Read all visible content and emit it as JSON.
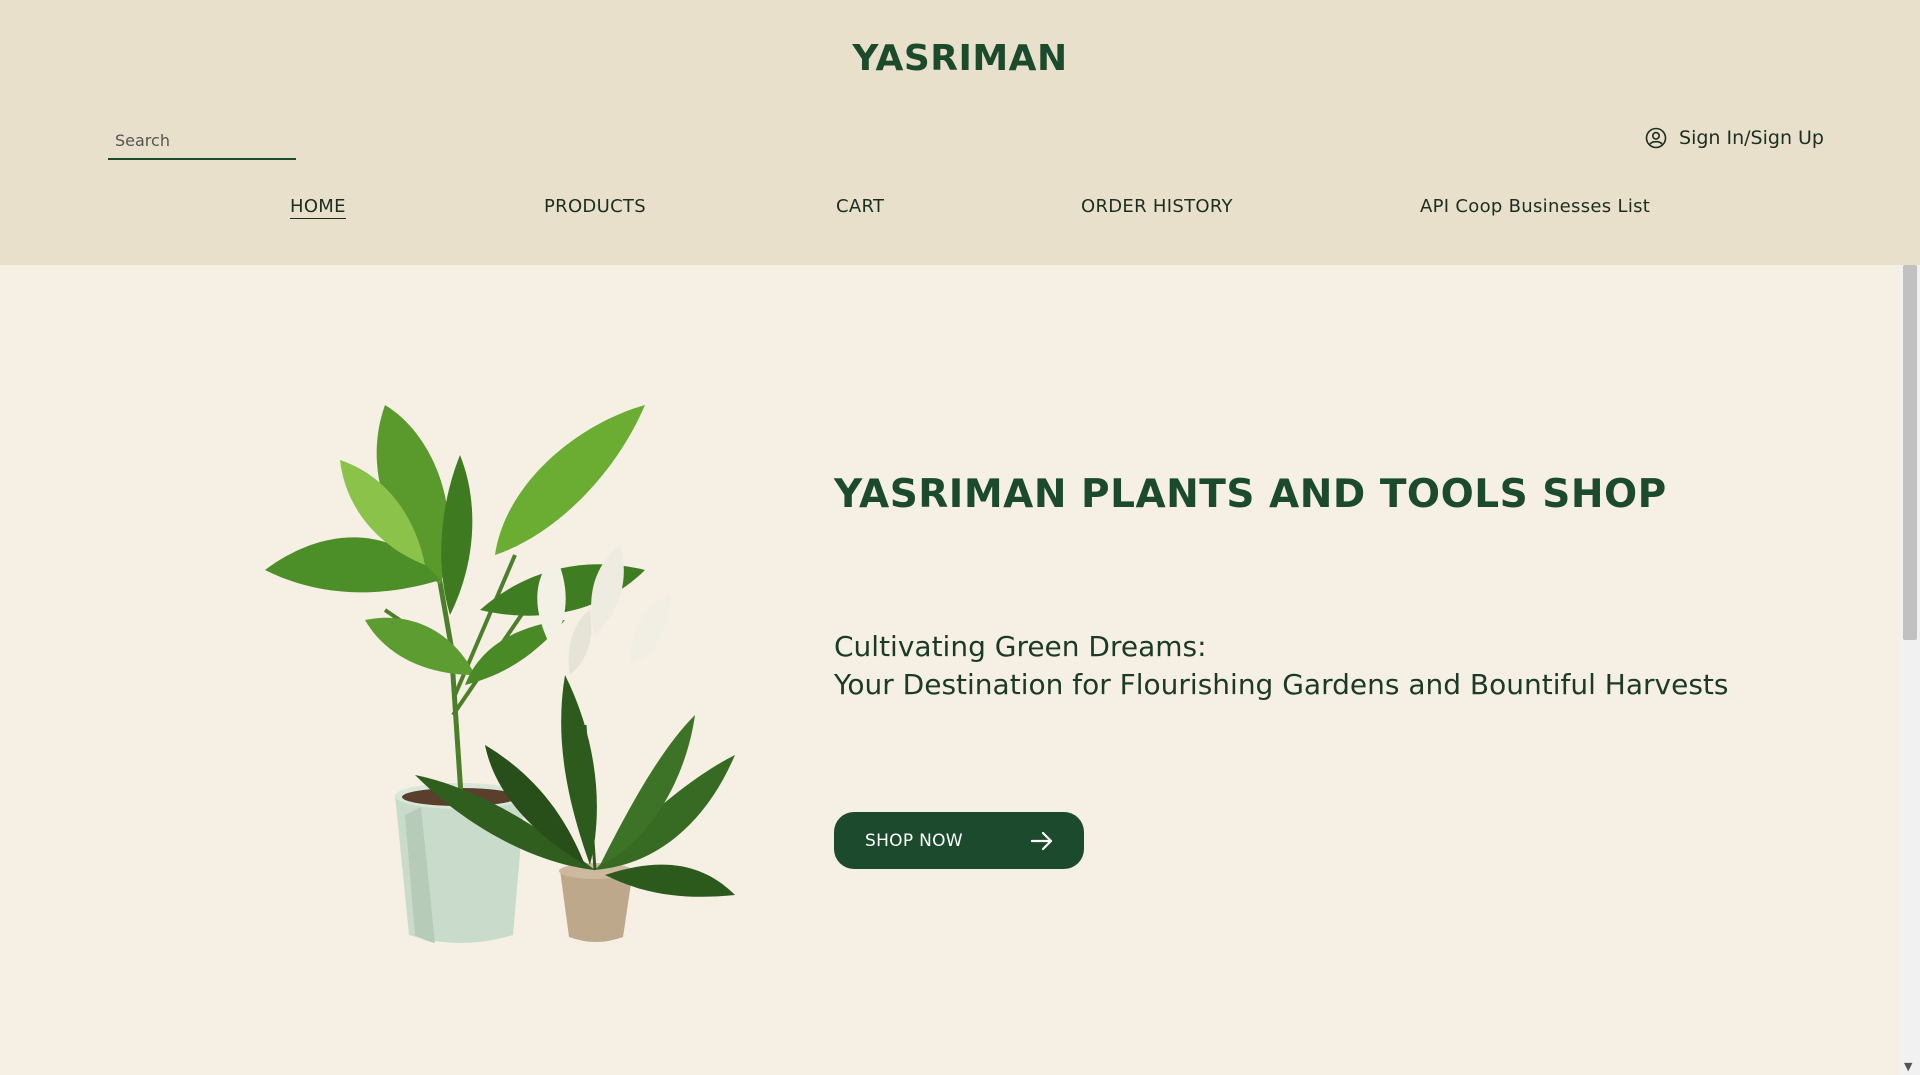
{
  "header": {
    "brand": "YASRIMAN",
    "search_placeholder": "Search",
    "signin_label": "Sign In/Sign Up"
  },
  "nav": {
    "items": [
      {
        "label": "HOME",
        "active": true
      },
      {
        "label": "PRODUCTS"
      },
      {
        "label": "CART"
      },
      {
        "label": "ORDER HISTORY"
      },
      {
        "label": "API Coop Businesses List"
      }
    ]
  },
  "hero": {
    "title": "YASRIMAN PLANTS AND TOOLS SHOP",
    "subtitle_line1": "Cultivating Green Dreams:",
    "subtitle_line2": "Your Destination for Flourishing Gardens and Bountiful Harvests",
    "cta_label": "SHOP NOW",
    "cta_icon": "arrow-right-icon"
  },
  "colors": {
    "header_bg": "#e8e0cb",
    "page_bg": "#f5efe4",
    "brand_green": "#1c4a2c"
  }
}
